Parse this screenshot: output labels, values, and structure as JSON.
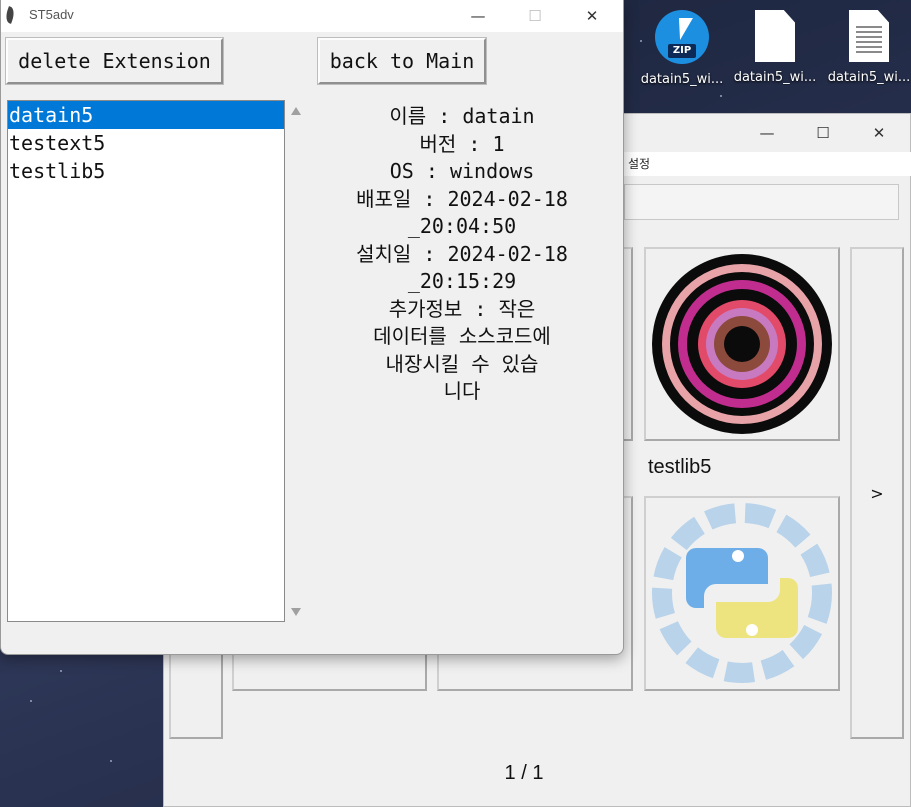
{
  "desktop": {
    "icons": [
      {
        "label": "datain5_wi...",
        "type": "zip-archive-icon"
      },
      {
        "label": "datain5_wi...",
        "type": "blank-file-icon"
      },
      {
        "label": "datain5_wi...",
        "type": "text-file-icon"
      }
    ]
  },
  "background_window": {
    "menu_label": "설정",
    "tiles": [
      {
        "name": "testlib5",
        "icon": "python-logo-icon"
      }
    ],
    "next_label": ">",
    "page_indicator": "1 / 1"
  },
  "window": {
    "title": "ST5adv",
    "controls": {
      "minimize": "—",
      "maximize": "☐",
      "close": "✕"
    },
    "buttons": {
      "delete": "delete Extension",
      "back": "back to Main"
    },
    "extensions": [
      "datain5",
      "testext5",
      "testlib5"
    ],
    "selected_extension": "datain5",
    "info_lines": [
      "이름 : datain",
      "버전 : 1",
      "OS : windows",
      "배포일 : 2024-02-18",
      "_20:04:50",
      "설치일 : 2024-02-18",
      "_20:15:29",
      "추가정보 : 작은",
      "데이터를 소스코드에",
      "내장시킬 수 있습",
      "니다"
    ]
  }
}
